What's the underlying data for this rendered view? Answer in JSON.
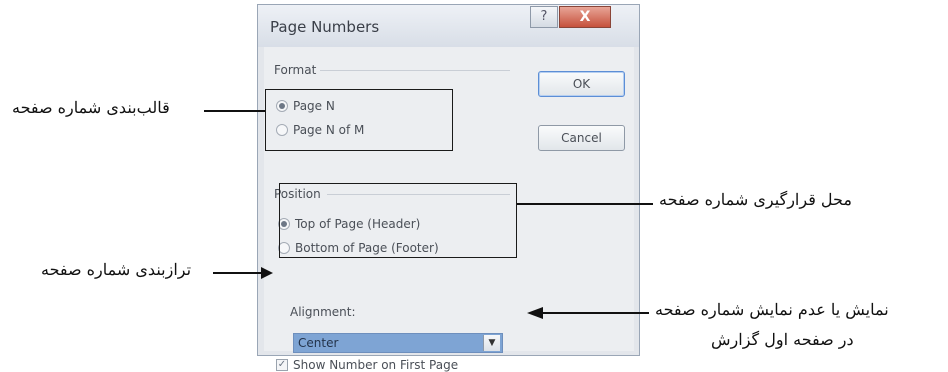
{
  "dialog": {
    "title": "Page Numbers",
    "help_glyph": "?",
    "close_glyph": "X",
    "format": {
      "group_label": "Format",
      "options": [
        "Page N",
        "Page N of M"
      ],
      "selected": "Page N"
    },
    "position": {
      "group_label": "Position",
      "options": [
        "Top of Page (Header)",
        "Bottom of Page (Footer)"
      ],
      "selected": "Top of Page (Header)"
    },
    "alignment": {
      "label": "Alignment:",
      "value": "Center",
      "dropdown_glyph": "▼"
    },
    "show_first": {
      "label": "Show Number on First Page",
      "checked": true,
      "check_glyph": "✓"
    },
    "ok_label": "OK",
    "cancel_label": "Cancel"
  },
  "annotations": {
    "format": "قالب‌بندی شماره صفحه",
    "position": "محل قرارگیری شماره صفحه",
    "alignment": "ترازبندی شماره صفحه",
    "first_page_line1": "نمایش یا عدم نمایش شماره صفحه",
    "first_page_line2": "در صفحه اول گزارش"
  },
  "colors": {
    "highlight_box": "#1a1a1a",
    "combo_selection": "#7ea4d4",
    "close_button": "#c6513c"
  }
}
